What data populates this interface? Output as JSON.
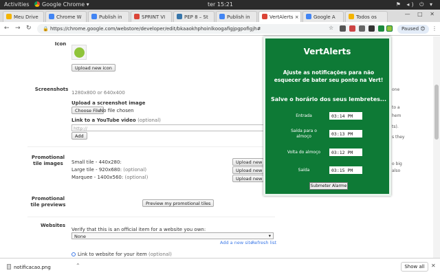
{
  "system": {
    "activities": "Activities",
    "app": "Google Chrome ▾",
    "clock": "ter 15:21",
    "tray": "⚑ ◂) ⏻ ▾"
  },
  "tabs": [
    {
      "label": "Meu Drive",
      "color": "#f4b400"
    },
    {
      "label": "Chrome W",
      "color": "#4285f4"
    },
    {
      "label": "Publish in",
      "color": "#4285f4"
    },
    {
      "label": "SPRINT VI",
      "color": "#db4437"
    },
    {
      "label": "PEP 8 – St",
      "color": "#3776ab"
    },
    {
      "label": "Publish in",
      "color": "#4285f4"
    },
    {
      "label": "VertAlerts",
      "color": "#db4437"
    },
    {
      "label": "Google A",
      "color": "#4285f4"
    },
    {
      "label": "Todos os",
      "color": "#f4b400"
    }
  ],
  "toolbar": {
    "url": "https://chrome.google.com/webstore/developer/edit/bkaaokhphoinlkoogafigjpgpofigjh#",
    "paused": "Paused"
  },
  "form": {
    "icon_label": "Icon",
    "upload_icon": "Upload new icon",
    "screenshots_label": "Screenshots",
    "screenshot_size": "1280x800 or 640x400",
    "upload_screenshot": "Upload a screenshot image",
    "choose_file": "Choose File",
    "no_file": "No file chosen",
    "youtube_label": "Link to a YouTube video",
    "optional": "(optional)",
    "youtube_placeholder": "http://",
    "add": "Add",
    "promo_tiles_label": "Promotional tile images",
    "small_tile": "Small tile - 440x280:",
    "large_tile": "Large tile - 920x680:",
    "marquee": "Marquee - 1400x560:",
    "upload_image": "Upload new image",
    "promo_previews_label": "Promotional tile previews",
    "preview_button": "Preview my promotional tiles",
    "websites_label": "Websites",
    "verify_text": "Verify that this is an official item for a website you own:",
    "none_option": "None",
    "add_site": "Add a new site",
    "refresh": "Refresh list",
    "link_website": "Link to website for your item",
    "right_text": [
      "one",
      "to a",
      "hem",
      "ts).",
      "s they",
      "o big",
      "also"
    ]
  },
  "popup": {
    "title": "VertAlerts",
    "description": "Ajuste as notificações para não esquecer de bater seu ponto na Vert!",
    "save": "Salve o horário dos seus lembretes...",
    "rows": [
      {
        "label": "Entrada",
        "value": "03:14 PM"
      },
      {
        "label": "Saída para o almoço",
        "value": "03:13 PM"
      },
      {
        "label": "Volta do almoço",
        "value": "03:12 PM"
      },
      {
        "label": "Saída",
        "value": "03:15 PM"
      }
    ],
    "submit": "Submeter Alarme",
    "bg_color": "#0e7a36"
  },
  "downloads": {
    "file": "notificacao.png",
    "show_all": "Show all"
  }
}
